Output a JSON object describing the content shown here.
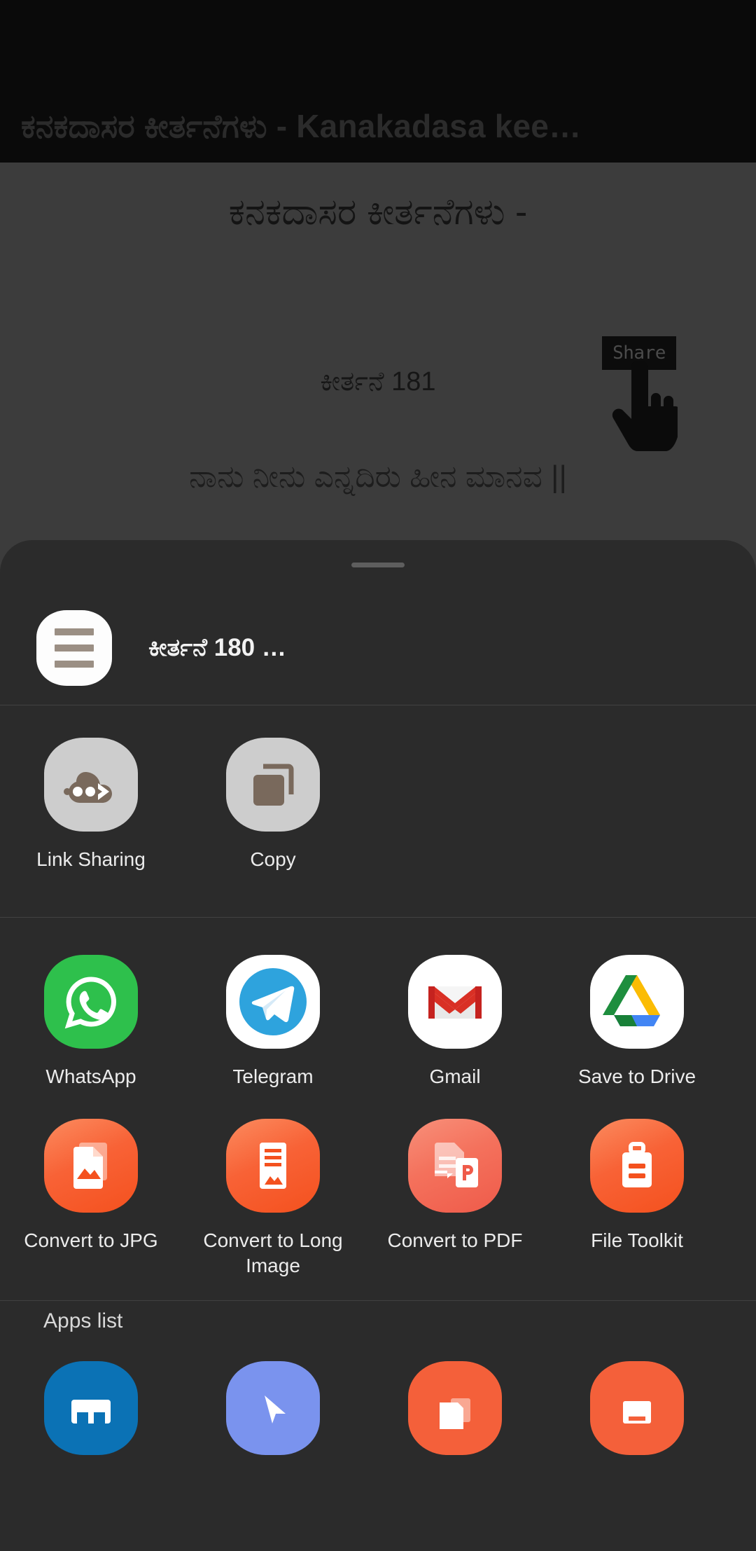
{
  "window": {
    "title": "ಕನಕದಾಸರ ಕೀರ್ತನೆಗಳು - Kanakadasa kee…"
  },
  "page": {
    "doc_title": "ಕನಕದಾಸರ ಕೀರ್ತನೆಗಳು -",
    "verse_number": "ಕೀರ್ತನೆ 181",
    "verse_line": "ನಾನು ನೀನು ಎನ್ನದಿರು ಹೀನ ಮಾನವ ||",
    "share_chip_label": "Share"
  },
  "sheet": {
    "header_title": "ಕೀರ್ತನೆ 180 …",
    "quick_actions": [
      {
        "label": "Link Sharing",
        "icon": "cloud-share-icon"
      },
      {
        "label": "Copy",
        "icon": "copy-icon"
      }
    ],
    "apps": [
      {
        "label": "WhatsApp",
        "icon": "whatsapp-icon"
      },
      {
        "label": "Telegram",
        "icon": "telegram-icon"
      },
      {
        "label": "Gmail",
        "icon": "gmail-icon"
      },
      {
        "label": "Save to Drive",
        "icon": "google-drive-icon"
      }
    ],
    "tools": [
      {
        "label": "Convert to JPG",
        "icon": "convert-jpg-icon"
      },
      {
        "label": "Convert to Long\nImage",
        "icon": "convert-long-image-icon"
      },
      {
        "label": "Convert to PDF",
        "icon": "convert-pdf-icon"
      },
      {
        "label": "File Toolkit",
        "icon": "file-toolkit-icon"
      }
    ],
    "apps_list_label": "Apps list"
  },
  "colors": {
    "sheet_bg": "#2b2b2b",
    "page_bg": "#3c3c3c",
    "titlebar_bg": "#0a0a0a",
    "accent_orange": "#f4511e",
    "whatsapp_green": "#2ec04c",
    "telegram_blue": "#2ea3dd",
    "gmail_red": "#d93025"
  }
}
